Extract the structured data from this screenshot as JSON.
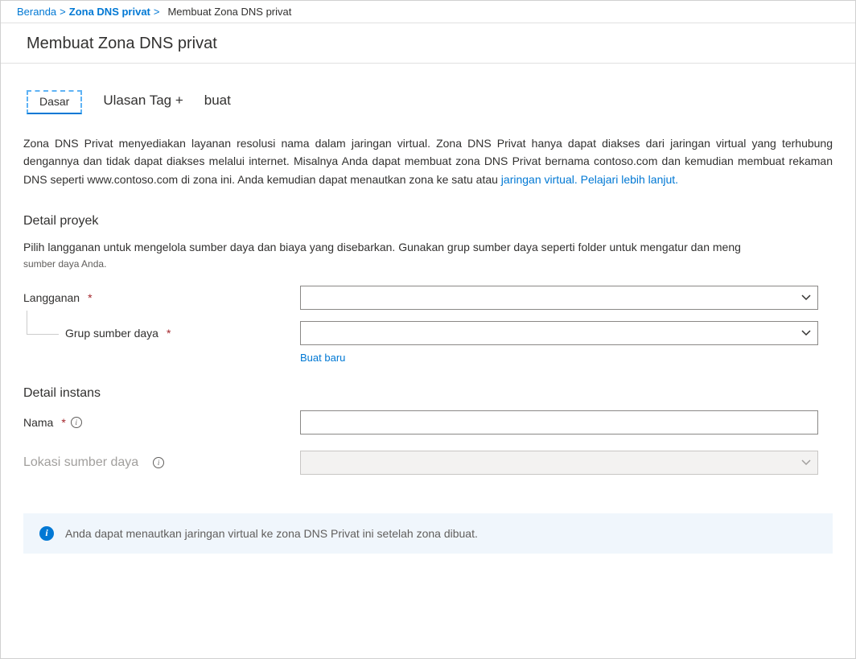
{
  "breadcrumb": {
    "home": "Beranda",
    "parent": "Zona DNS privat",
    "current": "Membuat Zona DNS privat"
  },
  "page_title": "Membuat Zona DNS privat",
  "tabs": {
    "basic": "Dasar",
    "review": "Ulasan Tag +",
    "create": "buat"
  },
  "description": {
    "text": "Zona DNS Privat menyediakan layanan resolusi nama dalam jaringan virtual. Zona DNS Privat hanya dapat diakses dari jaringan virtual yang terhubung dengannya dan tidak dapat diakses melalui internet. Misalnya Anda dapat membuat zona DNS Privat bernama contoso.com dan kemudian membuat rekaman DNS seperti www.contoso.com di zona ini. Anda kemudian dapat menautkan zona ke satu atau ",
    "link": "jaringan virtual. Pelajari lebih lanjut."
  },
  "project_details": {
    "heading": "Detail proyek",
    "sub1": "Pilih langganan untuk mengelola sumber daya dan biaya yang disebarkan. Gunakan grup sumber daya seperti folder untuk mengatur dan meng",
    "sub2": "sumber daya Anda.",
    "subscription_label": "Langganan",
    "resource_group_label": "Grup sumber daya",
    "create_new": "Buat baru"
  },
  "instance_details": {
    "heading": "Detail instans",
    "name_label": "Nama",
    "location_label": "Lokasi sumber daya"
  },
  "banner": {
    "text": "Anda dapat menautkan jaringan virtual ke zona DNS Privat ini setelah zona dibuat."
  }
}
